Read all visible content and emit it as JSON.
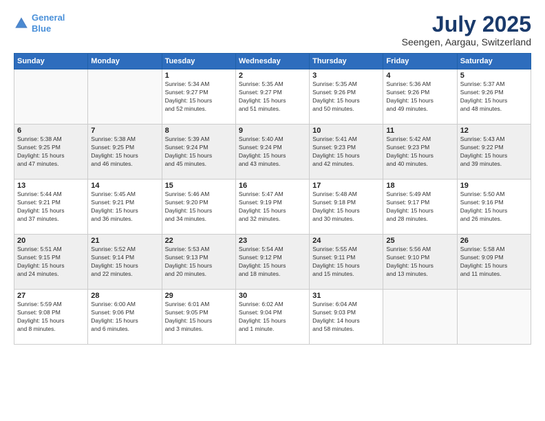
{
  "header": {
    "logo_line1": "General",
    "logo_line2": "Blue",
    "title": "July 2025",
    "subtitle": "Seengen, Aargau, Switzerland"
  },
  "weekdays": [
    "Sunday",
    "Monday",
    "Tuesday",
    "Wednesday",
    "Thursday",
    "Friday",
    "Saturday"
  ],
  "weeks": [
    [
      {
        "day": "",
        "info": ""
      },
      {
        "day": "",
        "info": ""
      },
      {
        "day": "1",
        "info": "Sunrise: 5:34 AM\nSunset: 9:27 PM\nDaylight: 15 hours\nand 52 minutes."
      },
      {
        "day": "2",
        "info": "Sunrise: 5:35 AM\nSunset: 9:27 PM\nDaylight: 15 hours\nand 51 minutes."
      },
      {
        "day": "3",
        "info": "Sunrise: 5:35 AM\nSunset: 9:26 PM\nDaylight: 15 hours\nand 50 minutes."
      },
      {
        "day": "4",
        "info": "Sunrise: 5:36 AM\nSunset: 9:26 PM\nDaylight: 15 hours\nand 49 minutes."
      },
      {
        "day": "5",
        "info": "Sunrise: 5:37 AM\nSunset: 9:26 PM\nDaylight: 15 hours\nand 48 minutes."
      }
    ],
    [
      {
        "day": "6",
        "info": "Sunrise: 5:38 AM\nSunset: 9:25 PM\nDaylight: 15 hours\nand 47 minutes."
      },
      {
        "day": "7",
        "info": "Sunrise: 5:38 AM\nSunset: 9:25 PM\nDaylight: 15 hours\nand 46 minutes."
      },
      {
        "day": "8",
        "info": "Sunrise: 5:39 AM\nSunset: 9:24 PM\nDaylight: 15 hours\nand 45 minutes."
      },
      {
        "day": "9",
        "info": "Sunrise: 5:40 AM\nSunset: 9:24 PM\nDaylight: 15 hours\nand 43 minutes."
      },
      {
        "day": "10",
        "info": "Sunrise: 5:41 AM\nSunset: 9:23 PM\nDaylight: 15 hours\nand 42 minutes."
      },
      {
        "day": "11",
        "info": "Sunrise: 5:42 AM\nSunset: 9:23 PM\nDaylight: 15 hours\nand 40 minutes."
      },
      {
        "day": "12",
        "info": "Sunrise: 5:43 AM\nSunset: 9:22 PM\nDaylight: 15 hours\nand 39 minutes."
      }
    ],
    [
      {
        "day": "13",
        "info": "Sunrise: 5:44 AM\nSunset: 9:21 PM\nDaylight: 15 hours\nand 37 minutes."
      },
      {
        "day": "14",
        "info": "Sunrise: 5:45 AM\nSunset: 9:21 PM\nDaylight: 15 hours\nand 36 minutes."
      },
      {
        "day": "15",
        "info": "Sunrise: 5:46 AM\nSunset: 9:20 PM\nDaylight: 15 hours\nand 34 minutes."
      },
      {
        "day": "16",
        "info": "Sunrise: 5:47 AM\nSunset: 9:19 PM\nDaylight: 15 hours\nand 32 minutes."
      },
      {
        "day": "17",
        "info": "Sunrise: 5:48 AM\nSunset: 9:18 PM\nDaylight: 15 hours\nand 30 minutes."
      },
      {
        "day": "18",
        "info": "Sunrise: 5:49 AM\nSunset: 9:17 PM\nDaylight: 15 hours\nand 28 minutes."
      },
      {
        "day": "19",
        "info": "Sunrise: 5:50 AM\nSunset: 9:16 PM\nDaylight: 15 hours\nand 26 minutes."
      }
    ],
    [
      {
        "day": "20",
        "info": "Sunrise: 5:51 AM\nSunset: 9:15 PM\nDaylight: 15 hours\nand 24 minutes."
      },
      {
        "day": "21",
        "info": "Sunrise: 5:52 AM\nSunset: 9:14 PM\nDaylight: 15 hours\nand 22 minutes."
      },
      {
        "day": "22",
        "info": "Sunrise: 5:53 AM\nSunset: 9:13 PM\nDaylight: 15 hours\nand 20 minutes."
      },
      {
        "day": "23",
        "info": "Sunrise: 5:54 AM\nSunset: 9:12 PM\nDaylight: 15 hours\nand 18 minutes."
      },
      {
        "day": "24",
        "info": "Sunrise: 5:55 AM\nSunset: 9:11 PM\nDaylight: 15 hours\nand 15 minutes."
      },
      {
        "day": "25",
        "info": "Sunrise: 5:56 AM\nSunset: 9:10 PM\nDaylight: 15 hours\nand 13 minutes."
      },
      {
        "day": "26",
        "info": "Sunrise: 5:58 AM\nSunset: 9:09 PM\nDaylight: 15 hours\nand 11 minutes."
      }
    ],
    [
      {
        "day": "27",
        "info": "Sunrise: 5:59 AM\nSunset: 9:08 PM\nDaylight: 15 hours\nand 8 minutes."
      },
      {
        "day": "28",
        "info": "Sunrise: 6:00 AM\nSunset: 9:06 PM\nDaylight: 15 hours\nand 6 minutes."
      },
      {
        "day": "29",
        "info": "Sunrise: 6:01 AM\nSunset: 9:05 PM\nDaylight: 15 hours\nand 3 minutes."
      },
      {
        "day": "30",
        "info": "Sunrise: 6:02 AM\nSunset: 9:04 PM\nDaylight: 15 hours\nand 1 minute."
      },
      {
        "day": "31",
        "info": "Sunrise: 6:04 AM\nSunset: 9:03 PM\nDaylight: 14 hours\nand 58 minutes."
      },
      {
        "day": "",
        "info": ""
      },
      {
        "day": "",
        "info": ""
      }
    ]
  ]
}
